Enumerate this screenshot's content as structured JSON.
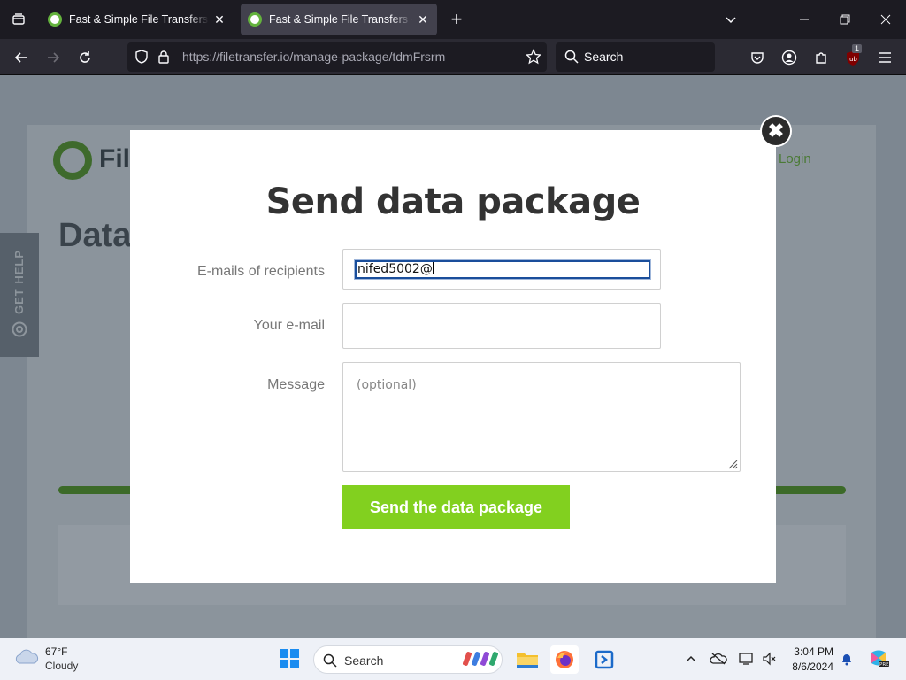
{
  "browser": {
    "tabs": [
      {
        "title": "Fast & Simple File Transfers - Fil",
        "active": false
      },
      {
        "title": "Fast & Simple File Transfers - Fil",
        "active": true
      }
    ],
    "url_host": "https://filetransfer.io",
    "url_path": "/manage-package/tdmFrsrm",
    "search_placeholder": "Search",
    "extension_badge": "1"
  },
  "background_page": {
    "logo_text": "Fil",
    "title": "Data",
    "login": "Login",
    "help_tab": "GET HELP"
  },
  "modal": {
    "title": "Send data package",
    "recipients_label": "E-mails of recipients",
    "recipients_value": "nifed5002@",
    "your_email_label": "Your e-mail",
    "your_email_value": "",
    "message_label": "Message",
    "message_placeholder": "(optional)",
    "send_button": "Send the data package",
    "close_symbol": "✖"
  },
  "taskbar": {
    "weather_temp": "67°F",
    "weather_condition": "Cloudy",
    "search_placeholder": "Search",
    "time": "3:04 PM",
    "date": "8/6/2024"
  },
  "colors": {
    "accent_green": "#82d01f",
    "modal_bg": "#ffffff",
    "browser_dark": "#1c1b22"
  }
}
